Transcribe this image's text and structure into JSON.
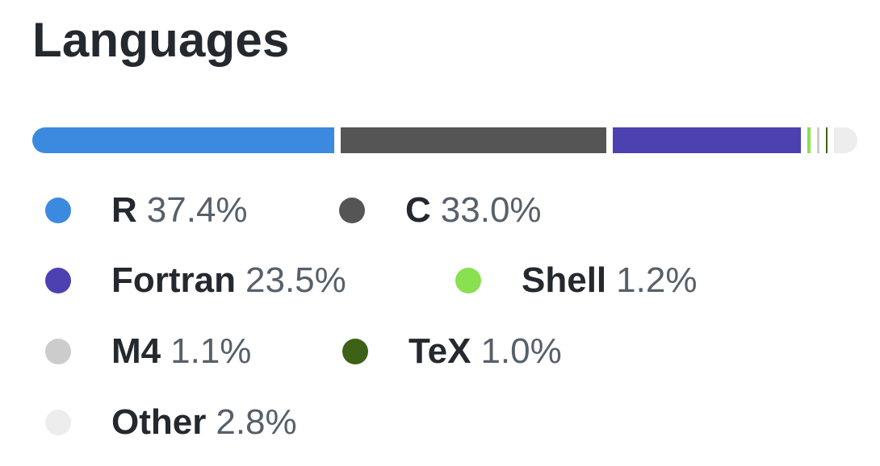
{
  "languages_panel": {
    "title": "Languages",
    "items": [
      {
        "name": "R",
        "percent": "37.4%",
        "value": 37.4,
        "color": "#3b8ae0"
      },
      {
        "name": "C",
        "percent": "33.0%",
        "value": 33.0,
        "color": "#555555"
      },
      {
        "name": "Fortran",
        "percent": "23.5%",
        "value": 23.5,
        "color": "#4d41b1"
      },
      {
        "name": "Shell",
        "percent": "1.2%",
        "value": 1.2,
        "color": "#89e051"
      },
      {
        "name": "M4",
        "percent": "1.1%",
        "value": 1.1,
        "color": "#cccccc"
      },
      {
        "name": "TeX",
        "percent": "1.0%",
        "value": 1.0,
        "color": "#3d6117"
      },
      {
        "name": "Other",
        "percent": "2.8%",
        "value": 2.8,
        "color": "#ededed"
      }
    ]
  }
}
